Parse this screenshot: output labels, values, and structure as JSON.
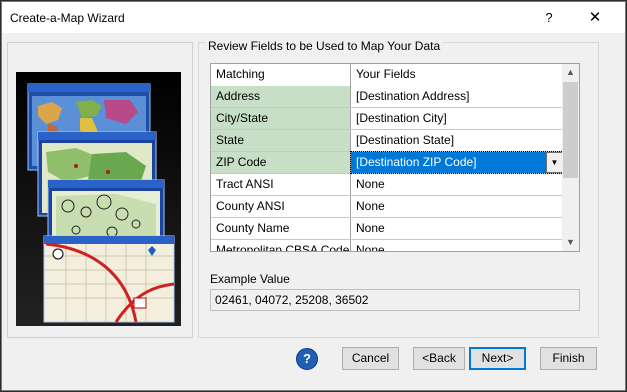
{
  "window": {
    "title": "Create-a-Map Wizard",
    "help_glyph": "?",
    "close_glyph": "✕"
  },
  "section": {
    "title": "Review Fields to be Used to Map Your Data"
  },
  "grid": {
    "headers": [
      "Matching",
      "Your Fields"
    ],
    "rows": [
      {
        "matching": "Address",
        "field": "[Destination Address]",
        "matched": true
      },
      {
        "matching": "City/State",
        "field": "[Destination City]",
        "matched": true
      },
      {
        "matching": "State",
        "field": "[Destination State]",
        "matched": true
      },
      {
        "matching": "ZIP Code",
        "field": "[Destination ZIP Code]",
        "matched": true,
        "selected": true
      },
      {
        "matching": "Tract ANSI",
        "field": "None",
        "matched": false
      },
      {
        "matching": "County ANSI",
        "field": "None",
        "matched": false
      },
      {
        "matching": "County Name",
        "field": "None",
        "matched": false
      },
      {
        "matching": "Metropolitan CBSA Code",
        "field": "None",
        "matched": false
      }
    ],
    "dropdown_glyph": "▼",
    "scroll_up_glyph": "▲",
    "scroll_down_glyph": "▼"
  },
  "example": {
    "label": "Example Value",
    "value": "02461, 04072, 25208, 36502"
  },
  "buttons": {
    "help": "?",
    "cancel": "Cancel",
    "back": "<Back",
    "next": "Next>",
    "finish": "Finish"
  },
  "colors": {
    "matched_row": "#c6dfc6",
    "selection": "#0078d7",
    "help_icon": "#1f5fb5"
  }
}
